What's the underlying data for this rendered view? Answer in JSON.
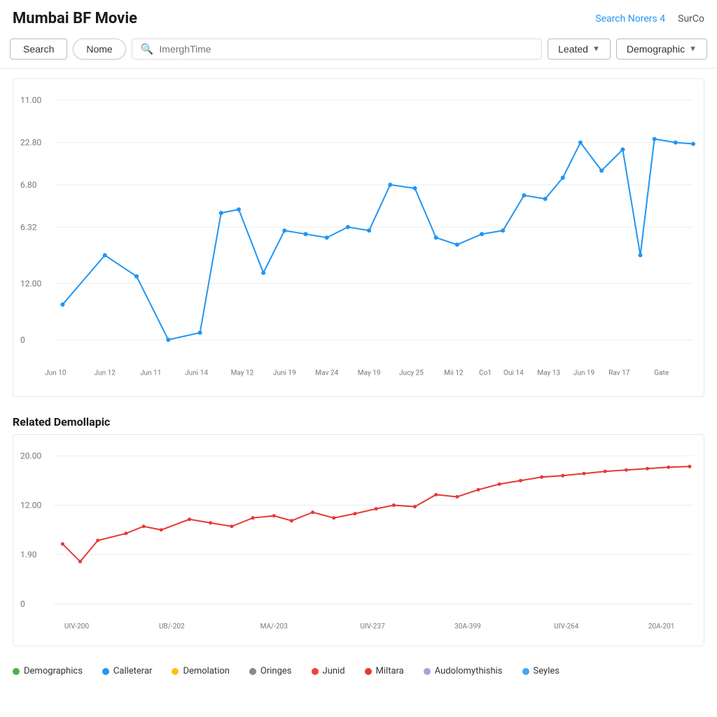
{
  "header": {
    "title": "Mumbai BF Movie",
    "search_norers_label": "Search Norers 4",
    "surco_label": "SurCo"
  },
  "toolbar": {
    "search_btn": "Search",
    "nome_btn": "Nome",
    "search_placeholder": "ImerghTime",
    "leated_btn": "Leated",
    "demographic_btn": "Demographic"
  },
  "main_chart": {
    "y_labels": [
      "11.00",
      "22.80",
      "6.80",
      "6.32",
      "12.00",
      "0"
    ],
    "x_labels": [
      "Jun 10",
      "Jun 12",
      "Jun 11",
      "Juni 14",
      "May 12",
      "Juni 19",
      "Mav 24",
      "May 19",
      "Jucy 25",
      "Mii 12",
      "Co1",
      "Oui 14",
      "May 13",
      "Jun 19",
      "Rav 17",
      "Gate"
    ]
  },
  "related_chart": {
    "title": "Related Demollapic",
    "y_labels": [
      "20.00",
      "12.00",
      "1.90",
      "0"
    ],
    "x_labels": [
      "UIV-200",
      "UB/-202",
      "MA/-203",
      "UIV-237",
      "30A-399",
      "UIV-264",
      "20A-201"
    ]
  },
  "legend": {
    "items": [
      {
        "label": "Demographics",
        "color": "#4CAF50"
      },
      {
        "label": "Calleterar",
        "color": "#2196F3"
      },
      {
        "label": "Demolation",
        "color": "#FFC107"
      },
      {
        "label": "Oringes",
        "color": "#888"
      },
      {
        "label": "Junid",
        "color": "#f44336"
      },
      {
        "label": "Miltara",
        "color": "#e53935"
      },
      {
        "label": "Audolomythishis",
        "color": "#b39ddb"
      },
      {
        "label": "Seyles",
        "color": "#42A5F5"
      }
    ]
  },
  "icons": {
    "search": "⌕",
    "chevron_down": "▾"
  }
}
